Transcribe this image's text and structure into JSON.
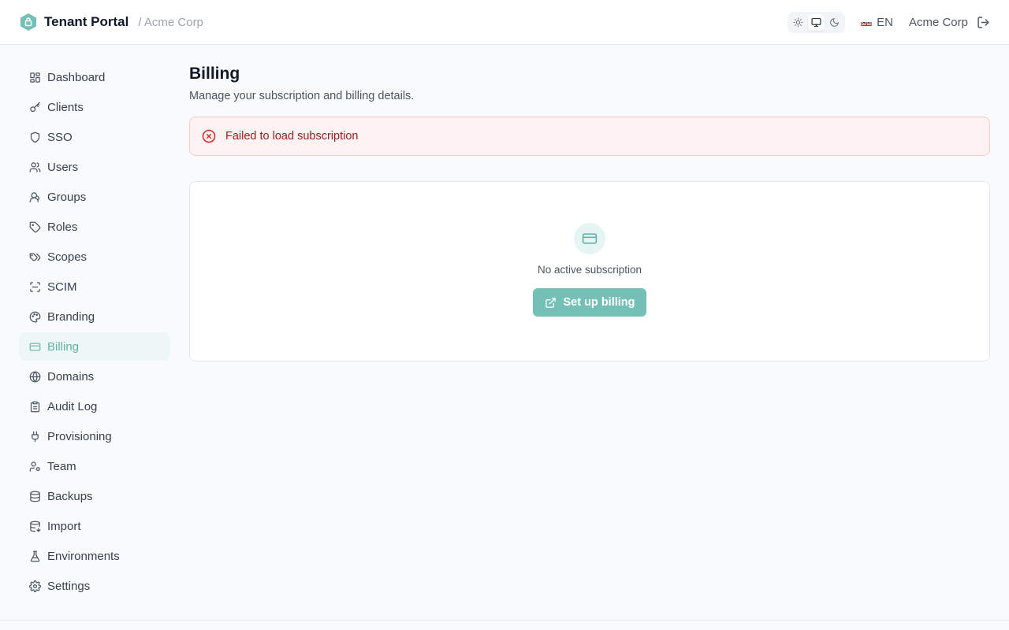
{
  "header": {
    "title": "Tenant Portal",
    "breadcrumb": "/ Acme Corp",
    "language": "EN",
    "tenant": "Acme Corp",
    "theme_modes": [
      "light",
      "system",
      "dark"
    ],
    "theme_selected": "system",
    "icons": {
      "logo": "shield-icon",
      "logout": "logout-icon"
    }
  },
  "sidebar": {
    "items": [
      {
        "label": "Dashboard",
        "icon": "dashboard-icon"
      },
      {
        "label": "Clients",
        "icon": "key-icon"
      },
      {
        "label": "SSO",
        "icon": "shield-icon"
      },
      {
        "label": "Users",
        "icon": "users-icon"
      },
      {
        "label": "Groups",
        "icon": "group-icon"
      },
      {
        "label": "Roles",
        "icon": "tag-icon"
      },
      {
        "label": "Scopes",
        "icon": "tags-icon"
      },
      {
        "label": "SCIM",
        "icon": "scan-icon"
      },
      {
        "label": "Branding",
        "icon": "palette-icon"
      },
      {
        "label": "Billing",
        "icon": "credit-card-icon",
        "active": true
      },
      {
        "label": "Domains",
        "icon": "globe-icon"
      },
      {
        "label": "Audit Log",
        "icon": "clipboard-icon"
      },
      {
        "label": "Provisioning",
        "icon": "plug-icon"
      },
      {
        "label": "Team",
        "icon": "user-cog-icon"
      },
      {
        "label": "Backups",
        "icon": "database-icon"
      },
      {
        "label": "Import",
        "icon": "database-import-icon"
      },
      {
        "label": "Environments",
        "icon": "flask-icon"
      },
      {
        "label": "Settings",
        "icon": "gear-icon"
      }
    ]
  },
  "main": {
    "title": "Billing",
    "subtitle": "Manage your subscription and billing details.",
    "alert": {
      "text": "Failed to load subscription",
      "icon": "error-circle-icon"
    },
    "empty": {
      "text": "No active subscription",
      "button": "Set up billing",
      "icon": "credit-card-icon",
      "button_icon": "external-link-icon"
    }
  },
  "colors": {
    "accent": "#74c0b6",
    "accent_light": "#e6f4f2",
    "error_bg": "#fef2f2",
    "error_border": "#fecaca",
    "error_text": "#991b1b"
  }
}
